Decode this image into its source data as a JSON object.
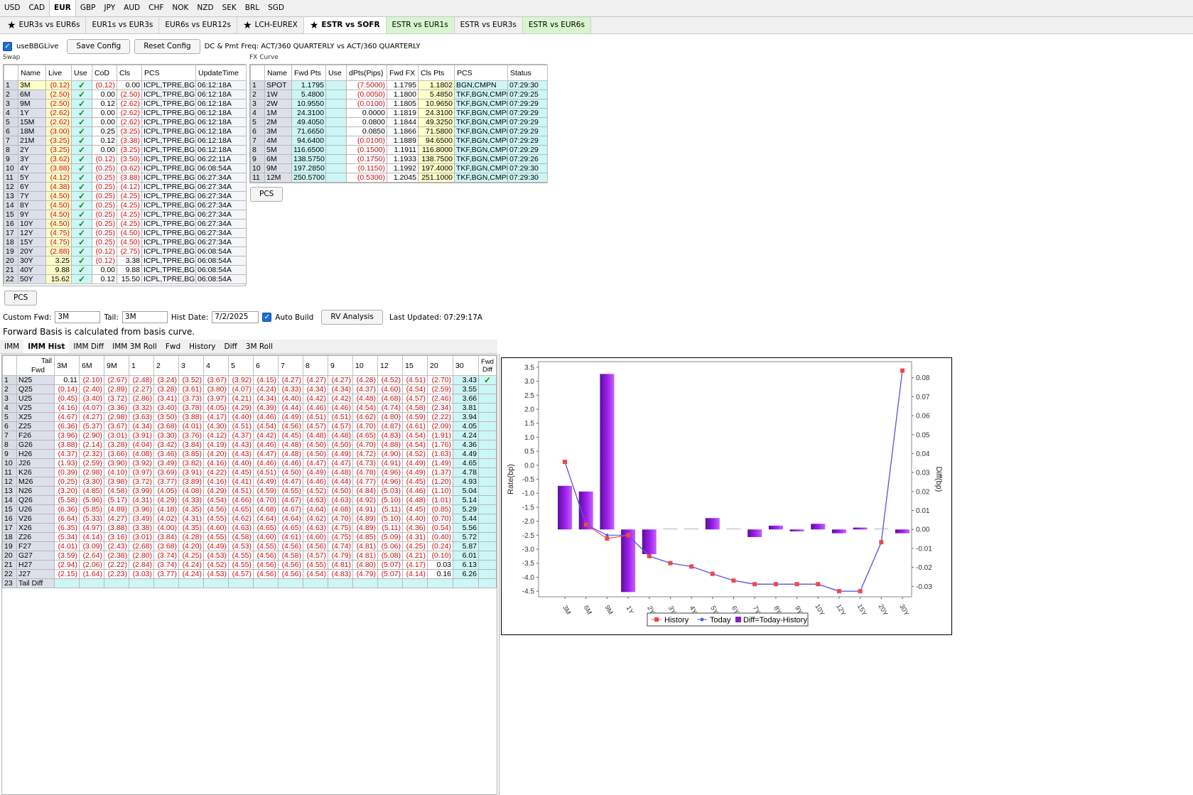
{
  "currency_tabs": [
    "USD",
    "CAD",
    "EUR",
    "GBP",
    "JPY",
    "AUD",
    "CHF",
    "NOK",
    "NZD",
    "SEK",
    "BRL",
    "SGD"
  ],
  "currency_active": 2,
  "sub_tabs": [
    {
      "label": "EUR3s vs EUR6s",
      "star": true,
      "green": false
    },
    {
      "label": "EUR1s vs EUR3s",
      "star": false,
      "green": false
    },
    {
      "label": "EUR6s vs EUR12s",
      "star": false,
      "green": false
    },
    {
      "label": "LCH-EUREX",
      "star": true,
      "green": false
    },
    {
      "label": "ESTR vs SOFR",
      "star": true,
      "green": false,
      "active": true
    },
    {
      "label": "ESTR vs EUR1s",
      "star": false,
      "green": true
    },
    {
      "label": "ESTR vs EUR3s",
      "star": false,
      "green": false
    },
    {
      "label": "ESTR vs EUR6s",
      "star": false,
      "green": true
    }
  ],
  "config": {
    "use_bbg_live": "useBBGLive",
    "save": "Save Config",
    "reset": "Reset Config",
    "dc_text": "DC & Pmt Freq: ACT/360 QUARTERLY vs ACT/360 QUARTERLY"
  },
  "swap": {
    "label": "Swap",
    "headers": [
      "",
      "Name",
      "Live",
      "Use",
      "CoD",
      "Cls",
      "PCS",
      "UpdateTime"
    ],
    "rows": [
      [
        "1",
        "3M",
        "(0.12)",
        "✓",
        "(0.12)",
        "0.00",
        "ICPL,TPRE,BGN",
        "06:12:18A"
      ],
      [
        "2",
        "6M",
        "(2.50)",
        "✓",
        "0.00",
        "(2.50)",
        "ICPL,TPRE,BGN",
        "06:12:18A"
      ],
      [
        "3",
        "9M",
        "(2.50)",
        "✓",
        "0.12",
        "(2.62)",
        "ICPL,TPRE,BGN",
        "06:12:18A"
      ],
      [
        "4",
        "1Y",
        "(2.62)",
        "✓",
        "0.00",
        "(2.62)",
        "ICPL,TPRE,BGN",
        "06:12:18A"
      ],
      [
        "5",
        "15M",
        "(2.62)",
        "✓",
        "0.00",
        "(2.62)",
        "ICPL,TPRE,BGN",
        "06:12:18A"
      ],
      [
        "6",
        "18M",
        "(3.00)",
        "✓",
        "0.25",
        "(3.25)",
        "ICPL,TPRE,BGN",
        "06:12:18A"
      ],
      [
        "7",
        "21M",
        "(3.25)",
        "✓",
        "0.12",
        "(3.38)",
        "ICPL,TPRE,BGN",
        "06:12:18A"
      ],
      [
        "8",
        "2Y",
        "(3.25)",
        "✓",
        "0.00",
        "(3.25)",
        "ICPL,TPRE,BGN",
        "06:12:18A"
      ],
      [
        "9",
        "3Y",
        "(3.62)",
        "✓",
        "(0.12)",
        "(3.50)",
        "ICPL,TPRE,BGN",
        "06:22:11A"
      ],
      [
        "10",
        "4Y",
        "(3.88)",
        "✓",
        "(0.25)",
        "(3.62)",
        "ICPL,TPRE,BGN",
        "06:08:54A"
      ],
      [
        "11",
        "5Y",
        "(4.12)",
        "✓",
        "(0.25)",
        "(3.88)",
        "ICPL,TPRE,BGN",
        "06:27:34A"
      ],
      [
        "12",
        "6Y",
        "(4.38)",
        "✓",
        "(0.25)",
        "(4.12)",
        "ICPL,TPRE,BGN",
        "06:27:34A"
      ],
      [
        "13",
        "7Y",
        "(4.50)",
        "✓",
        "(0.25)",
        "(4.25)",
        "ICPL,TPRE,BGN",
        "06:27:34A"
      ],
      [
        "14",
        "8Y",
        "(4.50)",
        "✓",
        "(0.25)",
        "(4.25)",
        "ICPL,TPRE,BGN",
        "06:27:34A"
      ],
      [
        "15",
        "9Y",
        "(4.50)",
        "✓",
        "(0.25)",
        "(4.25)",
        "ICPL,TPRE,BGN",
        "06:27:34A"
      ],
      [
        "16",
        "10Y",
        "(4.50)",
        "✓",
        "(0.25)",
        "(4.25)",
        "ICPL,TPRE,BGN",
        "06:27:34A"
      ],
      [
        "17",
        "12Y",
        "(4.75)",
        "✓",
        "(0.25)",
        "(4.50)",
        "ICPL,TPRE,BGN",
        "06:27:34A"
      ],
      [
        "18",
        "15Y",
        "(4.75)",
        "✓",
        "(0.25)",
        "(4.50)",
        "ICPL,TPRE,BGN",
        "06:27:34A"
      ],
      [
        "19",
        "20Y",
        "(2.88)",
        "✓",
        "(0.12)",
        "(2.75)",
        "ICPL,TPRE,BGN",
        "06:08:54A"
      ],
      [
        "20",
        "30Y",
        "3.25",
        "✓",
        "(0.12)",
        "3.38",
        "ICPL,TPRE,BGN",
        "06:08:54A"
      ],
      [
        "21",
        "40Y",
        "9.88",
        "✓",
        "0.00",
        "9.88",
        "ICPL,TPRE,BGN",
        "06:08:54A"
      ],
      [
        "22",
        "50Y",
        "15.62",
        "✓",
        "0.12",
        "15.50",
        "ICPL,TPRE,BGN",
        "06:08:54A"
      ]
    ],
    "pcs_button": "PCS"
  },
  "fx": {
    "label": "FX Curve",
    "headers": [
      "",
      "Name",
      "Fwd Pts",
      "Use",
      "dPts(Pips)",
      "Fwd FX",
      "Cls Pts",
      "PCS",
      "Status"
    ],
    "rows": [
      [
        "1",
        "SPOT",
        "1.1795",
        "",
        "(7.5000)",
        "1.1795",
        "1.1802",
        "BGN,CMPN",
        "07:29:30"
      ],
      [
        "2",
        "1W",
        "5.4800",
        "",
        "(0.0050)",
        "1.1800",
        "5.4850",
        "TKF,BGN,CMPN",
        "07:29:25"
      ],
      [
        "3",
        "2W",
        "10.9550",
        "",
        "(0.0100)",
        "1.1805",
        "10.9650",
        "TKF,BGN,CMPN",
        "07:29:29"
      ],
      [
        "4",
        "1M",
        "24.3100",
        "",
        "0.0000",
        "1.1819",
        "24.3100",
        "TKF,BGN,CMPN",
        "07:29:29"
      ],
      [
        "5",
        "2M",
        "49.4050",
        "",
        "0.0800",
        "1.1844",
        "49.3250",
        "TKF,BGN,CMPN",
        "07:29:29"
      ],
      [
        "6",
        "3M",
        "71.6650",
        "",
        "0.0850",
        "1.1866",
        "71.5800",
        "TKF,BGN,CMPN",
        "07:29:29"
      ],
      [
        "7",
        "4M",
        "94.6400",
        "",
        "(0.0100)",
        "1.1889",
        "94.6500",
        "TKF,BGN,CMPN",
        "07:29:29"
      ],
      [
        "8",
        "5M",
        "116.6500",
        "",
        "(0.1500)",
        "1.1911",
        "116.8000",
        "TKF,BGN,CMPN",
        "07:29:29"
      ],
      [
        "9",
        "6M",
        "138.5750",
        "",
        "(0.1750)",
        "1.1933",
        "138.7500",
        "TKF,BGN,CMPN",
        "07:29:26"
      ],
      [
        "10",
        "9M",
        "197.2850",
        "",
        "(0.1150)",
        "1.1992",
        "197.4000",
        "TKF,BGN,CMPN",
        "07:29:30"
      ],
      [
        "11",
        "12M",
        "250.5700",
        "",
        "(0.5300)",
        "1.2045",
        "251.1000",
        "TKF,BGN,CMPN",
        "07:29:30"
      ]
    ],
    "pcs_button": "PCS"
  },
  "fwd": {
    "custom_label": "Custom Fwd:",
    "custom_value": "3M",
    "tail_label": "Tail:",
    "tail_value": "3M",
    "hist_label": "Hist Date:",
    "hist_value": "7/2/2025",
    "auto_build": "Auto Build",
    "rv_button": "RV Analysis",
    "last_updated": "Last Updated: 07:29:17A"
  },
  "note": "Forward Basis is calculated from basis curve.",
  "bottom_tabs": [
    "IMM",
    "IMM Hist",
    "IMM Diff",
    "IMM 3M Roll",
    "Fwd",
    "History",
    "Diff",
    "3M Roll"
  ],
  "bottom_active": 1,
  "imm": {
    "corner_tail": "Tail",
    "corner_fwd": "Fwd",
    "cols": [
      "3M",
      "6M",
      "9M",
      "1",
      "2",
      "3",
      "4",
      "5",
      "6",
      "7",
      "8",
      "9",
      "10",
      "12",
      "15",
      "20",
      "30"
    ],
    "last_col": "Fwd Diff",
    "rows": [
      [
        "N25",
        "0.11",
        "(2.10)",
        "(2.67)",
        "(2.48)",
        "(3.24)",
        "(3.52)",
        "(3.67)",
        "(3.92)",
        "(4.15)",
        "(4.27)",
        "(4.27)",
        "(4.27)",
        "(4.28)",
        "(4.52)",
        "(4.51)",
        "(2.70)",
        "3.43",
        "✓"
      ],
      [
        "Q25",
        "(0.14)",
        "(2.40)",
        "(2.89)",
        "(2.27)",
        "(3.28)",
        "(3.61)",
        "(3.80)",
        "(4.07)",
        "(4.24)",
        "(4.33)",
        "(4.34)",
        "(4.34)",
        "(4.37)",
        "(4.60)",
        "(4.54)",
        "(2.59)",
        "3.55",
        ""
      ],
      [
        "U25",
        "(0.45)",
        "(3.40)",
        "(3.72)",
        "(2.86)",
        "(3.41)",
        "(3.73)",
        "(3.97)",
        "(4.21)",
        "(4.34)",
        "(4.40)",
        "(4.42)",
        "(4.42)",
        "(4.48)",
        "(4.68)",
        "(4.57)",
        "(2.46)",
        "3.66",
        ""
      ],
      [
        "V25",
        "(4.16)",
        "(4.07)",
        "(3.36)",
        "(3.32)",
        "(3.40)",
        "(3.78)",
        "(4.05)",
        "(4.29)",
        "(4.39)",
        "(4.44)",
        "(4.46)",
        "(4.46)",
        "(4.54)",
        "(4.74)",
        "(4.58)",
        "(2.34)",
        "3.81",
        ""
      ],
      [
        "X25",
        "(4.67)",
        "(4.27)",
        "(2.98)",
        "(3.63)",
        "(3.50)",
        "(3.88)",
        "(4.17)",
        "(4.40)",
        "(4.46)",
        "(4.49)",
        "(4.51)",
        "(4.51)",
        "(4.62)",
        "(4.80)",
        "(4.59)",
        "(2.22)",
        "3.94",
        ""
      ],
      [
        "Z25",
        "(6.36)",
        "(5.37)",
        "(3.67)",
        "(4.34)",
        "(3.68)",
        "(4.01)",
        "(4.30)",
        "(4.51)",
        "(4.54)",
        "(4.56)",
        "(4.57)",
        "(4.57)",
        "(4.70)",
        "(4.87)",
        "(4.61)",
        "(2.09)",
        "4.05",
        ""
      ],
      [
        "F26",
        "(3.96)",
        "(2.90)",
        "(3.01)",
        "(3.91)",
        "(3.30)",
        "(3.76)",
        "(4.12)",
        "(4.37)",
        "(4.42)",
        "(4.45)",
        "(4.48)",
        "(4.48)",
        "(4.65)",
        "(4.83)",
        "(4.54)",
        "(1.91)",
        "4.24",
        ""
      ],
      [
        "G26",
        "(3.88)",
        "(2.14)",
        "(3.28)",
        "(4.04)",
        "(3.42)",
        "(3.84)",
        "(4.19)",
        "(4.43)",
        "(4.46)",
        "(4.48)",
        "(4.50)",
        "(4.50)",
        "(4.70)",
        "(4.88)",
        "(4.54)",
        "(1.76)",
        "4.36",
        ""
      ],
      [
        "H26",
        "(4.37)",
        "(2.32)",
        "(3.66)",
        "(4.08)",
        "(3.46)",
        "(3.85)",
        "(4.20)",
        "(4.43)",
        "(4.47)",
        "(4.48)",
        "(4.50)",
        "(4.49)",
        "(4.72)",
        "(4.90)",
        "(4.52)",
        "(1.63)",
        "4.49",
        ""
      ],
      [
        "J26",
        "(1.93)",
        "(2.59)",
        "(3.90)",
        "(3.92)",
        "(3.49)",
        "(3.82)",
        "(4.16)",
        "(4.40)",
        "(4.46)",
        "(4.46)",
        "(4.47)",
        "(4.47)",
        "(4.73)",
        "(4.91)",
        "(4.49)",
        "(1.49)",
        "4.65",
        ""
      ],
      [
        "K26",
        "(0.39)",
        "(2.98)",
        "(4.10)",
        "(3.97)",
        "(3.69)",
        "(3.91)",
        "(4.22)",
        "(4.45)",
        "(4.51)",
        "(4.50)",
        "(4.49)",
        "(4.48)",
        "(4.78)",
        "(4.96)",
        "(4.49)",
        "(1.37)",
        "4.78",
        ""
      ],
      [
        "M26",
        "(0.25)",
        "(3.30)",
        "(3.98)",
        "(3.72)",
        "(3.77)",
        "(3.89)",
        "(4.16)",
        "(4.41)",
        "(4.49)",
        "(4.47)",
        "(4.46)",
        "(4.44)",
        "(4.77)",
        "(4.96)",
        "(4.45)",
        "(1.20)",
        "4.93",
        ""
      ],
      [
        "N26",
        "(3.20)",
        "(4.85)",
        "(4.58)",
        "(3.99)",
        "(4.05)",
        "(4.08)",
        "(4.29)",
        "(4.51)",
        "(4.59)",
        "(4.55)",
        "(4.52)",
        "(4.50)",
        "(4.84)",
        "(5.03)",
        "(4.46)",
        "(1.10)",
        "5.04",
        ""
      ],
      [
        "Q26",
        "(5.58)",
        "(5.96)",
        "(5.17)",
        "(4.31)",
        "(4.29)",
        "(4.33)",
        "(4.54)",
        "(4.66)",
        "(4.70)",
        "(4.67)",
        "(4.63)",
        "(4.63)",
        "(4.92)",
        "(5.10)",
        "(4.48)",
        "(1.01)",
        "5.14",
        ""
      ],
      [
        "U26",
        "(6.36)",
        "(5.85)",
        "(4.89)",
        "(3.96)",
        "(4.18)",
        "(4.35)",
        "(4.56)",
        "(4.65)",
        "(4.68)",
        "(4.67)",
        "(4.64)",
        "(4.68)",
        "(4.91)",
        "(5.11)",
        "(4.45)",
        "(0.85)",
        "5.29",
        ""
      ],
      [
        "V26",
        "(6.64)",
        "(5.33)",
        "(4.27)",
        "(3.49)",
        "(4.02)",
        "(4.31)",
        "(4.55)",
        "(4.62)",
        "(4.64)",
        "(4.64)",
        "(4.62)",
        "(4.70)",
        "(4.89)",
        "(5.10)",
        "(4.40)",
        "(0.70)",
        "5.44",
        ""
      ],
      [
        "X26",
        "(6.35)",
        "(4.97)",
        "(3.88)",
        "(3.38)",
        "(4.00)",
        "(4.35)",
        "(4.60)",
        "(4.63)",
        "(4.65)",
        "(4.65)",
        "(4.63)",
        "(4.75)",
        "(4.89)",
        "(5.11)",
        "(4.36)",
        "(0.54)",
        "5.56",
        ""
      ],
      [
        "Z26",
        "(5.34)",
        "(4.14)",
        "(3.16)",
        "(3.01)",
        "(3.84)",
        "(4.28)",
        "(4.55)",
        "(4.58)",
        "(4.60)",
        "(4.61)",
        "(4.60)",
        "(4.75)",
        "(4.85)",
        "(5.09)",
        "(4.31)",
        "(0.40)",
        "5.72",
        ""
      ],
      [
        "F27",
        "(4.01)",
        "(3.09)",
        "(2.43)",
        "(2.68)",
        "(3.68)",
        "(4.20)",
        "(4.49)",
        "(4.53)",
        "(4.55)",
        "(4.56)",
        "(4.56)",
        "(4.74)",
        "(4.81)",
        "(5.06)",
        "(4.25)",
        "(0.24)",
        "5.87",
        ""
      ],
      [
        "G27",
        "(3.59)",
        "(2.64)",
        "(2.38)",
        "(2.80)",
        "(3.74)",
        "(4.25)",
        "(4.53)",
        "(4.55)",
        "(4.56)",
        "(4.58)",
        "(4.57)",
        "(4.79)",
        "(4.81)",
        "(5.08)",
        "(4.21)",
        "(0.10)",
        "6.01",
        ""
      ],
      [
        "H27",
        "(2.94)",
        "(2.06)",
        "(2.22)",
        "(2.84)",
        "(3.74)",
        "(4.24)",
        "(4.52)",
        "(4.55)",
        "(4.56)",
        "(4.56)",
        "(4.55)",
        "(4.81)",
        "(4.80)",
        "(5.07)",
        "(4.17)",
        "0.03",
        "6.13",
        ""
      ],
      [
        "J27",
        "(2.15)",
        "(1.64)",
        "(2.23)",
        "(3.03)",
        "(3.77)",
        "(4.24)",
        "(4.53)",
        "(4.57)",
        "(4.56)",
        "(4.56)",
        "(4.54)",
        "(4.83)",
        "(4.79)",
        "(5.07)",
        "(4.14)",
        "0.16",
        "6.26",
        ""
      ]
    ],
    "tail_row_label": "Tail Diff"
  },
  "chart_data": {
    "type": "bar",
    "categories": [
      "3M",
      "6M",
      "9M",
      "1Y",
      "2Y",
      "3Y",
      "4Y",
      "5Y",
      "6Y",
      "7Y",
      "8Y",
      "9Y",
      "10Y",
      "12Y",
      "15Y",
      "20Y",
      "30Y"
    ],
    "ylabel": "Rate(bp)",
    "y2label": "Diff(bp)",
    "ylim": [
      -4.7,
      3.7
    ],
    "y2lim": [
      -0.0355,
      0.0885
    ],
    "yticks": [
      "3.5",
      "3.0",
      "2.5",
      "2.0",
      "1.5",
      "1.0",
      "0.5",
      "0.0",
      "-0.5",
      "-1.0",
      "-1.5",
      "-2.0",
      "-2.5",
      "-3.0",
      "-3.5",
      "-4.0",
      "-4.5"
    ],
    "y2ticks": [
      "0.08",
      "0.07",
      "0.06",
      "0.05",
      "0.04",
      "0.03",
      "0.02",
      "0.01",
      "0.00",
      "-0.01",
      "-0.02",
      "-0.03"
    ],
    "series": [
      {
        "name": "History",
        "kind": "line",
        "axis": "left",
        "color": "#f04848",
        "values": [
          0.12,
          -2.12,
          -2.62,
          -2.5,
          -3.25,
          -3.5,
          -3.62,
          -3.88,
          -4.12,
          -4.25,
          -4.25,
          -4.25,
          -4.25,
          -4.5,
          -4.5,
          -2.75,
          3.38
        ]
      },
      {
        "name": "Today",
        "kind": "line",
        "axis": "left",
        "color": "#4a5cf0",
        "values": [
          0.12,
          -2.12,
          -2.5,
          -2.5,
          -3.25,
          -3.5,
          -3.62,
          -3.88,
          -4.12,
          -4.25,
          -4.25,
          -4.25,
          -4.25,
          -4.5,
          -4.5,
          -2.75,
          3.38
        ]
      },
      {
        "name": "Diff=Today-History",
        "kind": "bar",
        "axis": "right",
        "color": "#8a1cc8",
        "values": [
          0.023,
          0.02,
          0.082,
          -0.033,
          -0.013,
          0.0,
          0.0,
          0.006,
          0.0,
          -0.004,
          0.002,
          -0.001,
          0.003,
          -0.002,
          0.001,
          0.0,
          -0.002
        ]
      }
    ],
    "legend": "bottom"
  }
}
